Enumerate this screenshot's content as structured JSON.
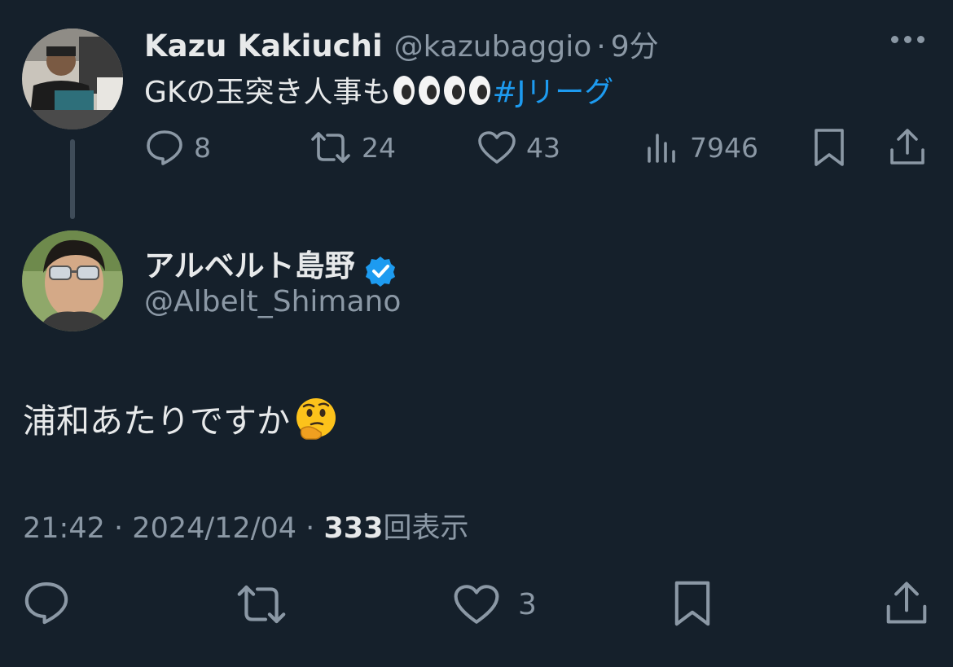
{
  "parent_tweet": {
    "author_name": "Kazu Kakiuchi",
    "author_handle": "@kazubaggio",
    "separator": "·",
    "time_ago": "9分",
    "text": "GKの玉突き人事も",
    "emojis": [
      "eyes",
      "eyes"
    ],
    "hashtag": "#Jリーグ",
    "replies": "8",
    "retweets": "24",
    "likes": "43",
    "views": "7946"
  },
  "reply_tweet": {
    "author_name": "アルベルト島野",
    "verified": true,
    "verified_color": "#1d9bf0",
    "author_handle": "@Albelt_Shimano",
    "text": "浦和あたりですか",
    "emoji": "thinking-face",
    "time": "21:42",
    "separator1": "·",
    "date": "2024/12/04",
    "separator2": "·",
    "views_count": "333",
    "views_label": "回表示",
    "likes": "3"
  },
  "colors": {
    "background": "#15202b",
    "text": "#e7e9ea",
    "muted": "#8b98a5",
    "link": "#1d9bf0"
  }
}
